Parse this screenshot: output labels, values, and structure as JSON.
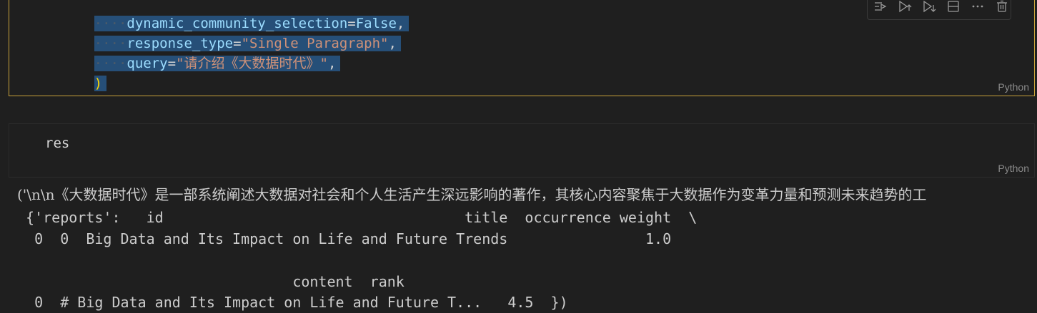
{
  "cell1": {
    "lines": [
      {
        "param": "dynamic_community_selection",
        "eq": "=",
        "value": "False",
        "tail": ","
      },
      {
        "param": "response_type",
        "eq": "=",
        "value": "\"Single Paragraph\"",
        "tail": ","
      },
      {
        "param": "query",
        "eq": "=",
        "value": "\"请介绍《大数据时代》\"",
        "tail": ","
      }
    ],
    "close_paren": ")",
    "language": "Python"
  },
  "toolbar": {
    "icons": [
      "run-by-line-icon",
      "execute-above-icon",
      "execute-below-icon",
      "split-cell-icon",
      "more-actions-icon",
      "delete-cell-icon"
    ]
  },
  "cell2": {
    "code": "res",
    "language": "Python"
  },
  "output": {
    "line1": "('\\n\\n《大数据时代》是一部系统阐述大数据对社会和个人生活产生深远影响的著作，其核心内容聚焦于大数据作为变革力量和预测未来趋势的工",
    "line2": " {'reports':   id                                   title  occurrence weight  \\",
    "line3": "  0  0  Big Data and Its Impact on Life and Future Trends                1.0",
    "line4": "",
    "line5": "                                content  rank",
    "line6": "  0  # Big Data and Its Impact on Life and Future T...   4.5  })"
  }
}
